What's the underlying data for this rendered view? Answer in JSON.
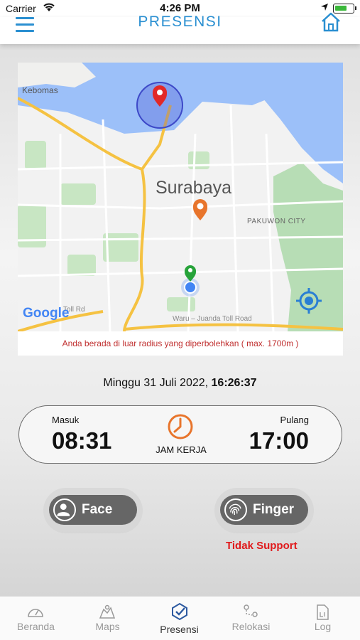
{
  "status_bar": {
    "carrier": "Carrier",
    "time": "4:26 PM"
  },
  "header": {
    "title": "PRESENSI",
    "menu_icon": "hamburger-menu-icon",
    "home_icon": "home-icon",
    "accent_color": "#2a8fd1"
  },
  "map": {
    "labels": {
      "city": "Surabaya",
      "kebomas": "Kebomas",
      "pakuwon": "PAKUWON CITY",
      "toll_road_a": "Toll Rd",
      "toll_road_b": "Waru – Juanda Toll Road",
      "google": "Google"
    },
    "warning": "Anda berada di luar radius yang diperbolehkan ( max. 1700m )",
    "warning_color": "#c03030"
  },
  "datetime": {
    "date": "Minggu 31 Juli 2022,",
    "time": "16:26:37"
  },
  "work_hours": {
    "masuk_label": "Masuk",
    "masuk_value": "08:31",
    "center_label": "JAM KERJA",
    "pulang_label": "Pulang",
    "pulang_value": "17:00",
    "clock_color": "#e8752c"
  },
  "actions": {
    "face_label": "Face",
    "finger_label": "Finger",
    "finger_note": "Tidak Support",
    "note_color": "#e0191b"
  },
  "bottom_nav": {
    "items": [
      {
        "label": "Beranda",
        "icon": "dashboard-icon",
        "active": false
      },
      {
        "label": "Maps",
        "icon": "map-icon",
        "active": false
      },
      {
        "label": "Presensi",
        "icon": "presensi-check-icon",
        "active": true
      },
      {
        "label": "Relokasi",
        "icon": "relocation-icon",
        "active": false
      },
      {
        "label": "Log",
        "icon": "log-icon",
        "active": false
      }
    ]
  }
}
